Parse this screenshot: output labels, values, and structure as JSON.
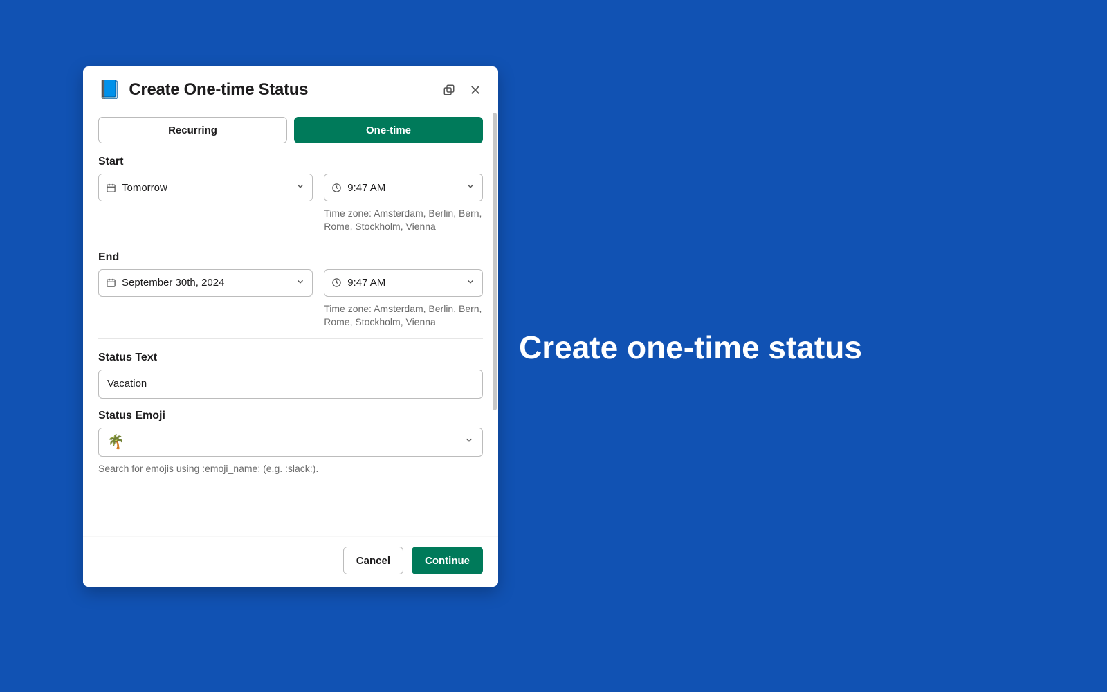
{
  "caption": "Create one-time status",
  "modal": {
    "title": "Create One-time Status",
    "appIcon": "📘",
    "tabs": {
      "recurring": "Recurring",
      "onetime": "One-time"
    },
    "start": {
      "label": "Start",
      "date": "Tomorrow",
      "time": "9:47 AM",
      "timezone": "Time zone: Amsterdam, Berlin, Bern, Rome, Stockholm, Vienna"
    },
    "end": {
      "label": "End",
      "date": "September 30th, 2024",
      "time": "9:47 AM",
      "timezone": "Time zone: Amsterdam, Berlin, Bern, Rome, Stockholm, Vienna"
    },
    "statusText": {
      "label": "Status Text",
      "value": "Vacation"
    },
    "statusEmoji": {
      "label": "Status Emoji",
      "value": "🌴",
      "helper": "Search for emojis using :emoji_name: (e.g. :slack:)."
    },
    "footer": {
      "cancel": "Cancel",
      "continue": "Continue"
    }
  }
}
